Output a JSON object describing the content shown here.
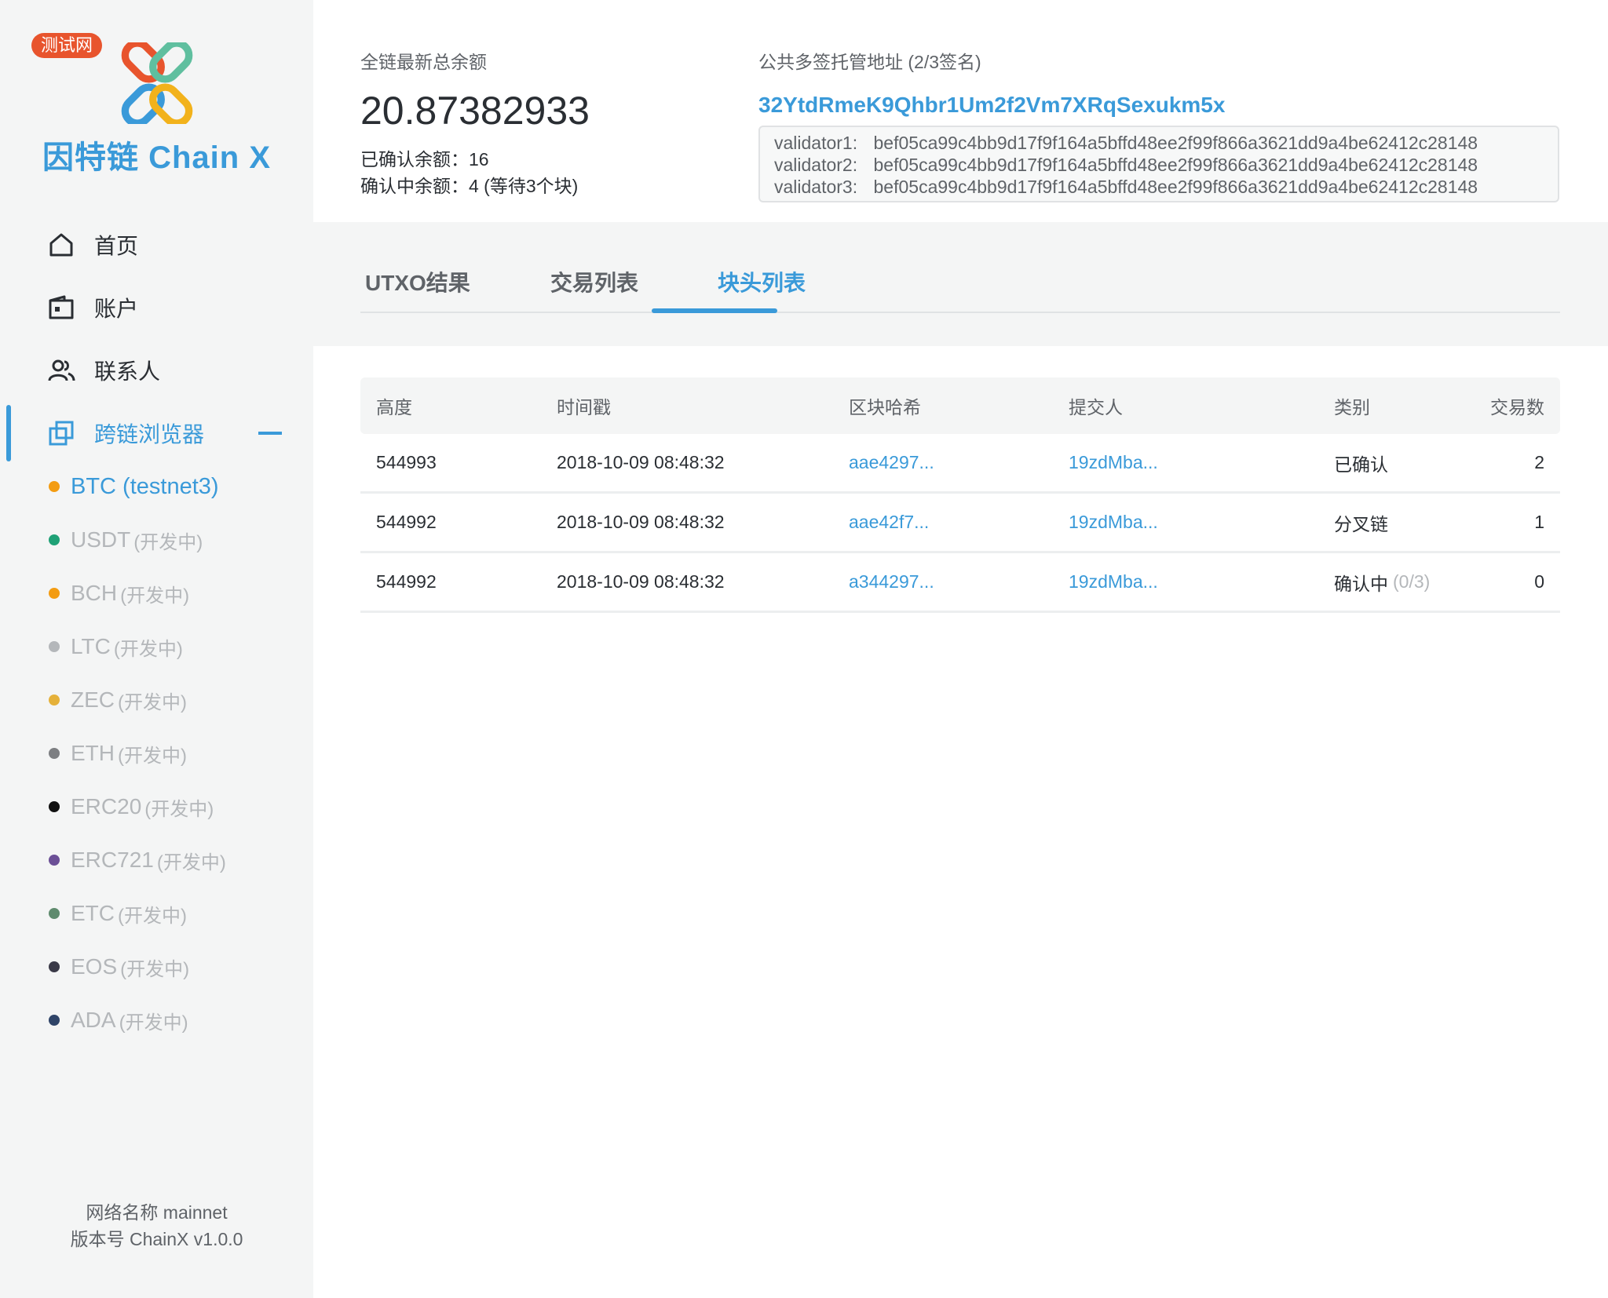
{
  "brand": {
    "test_badge": "测试网",
    "logo_text": "因特链 Chain X"
  },
  "nav": {
    "items": [
      {
        "label": "首页",
        "icon": "home-icon"
      },
      {
        "label": "账户",
        "icon": "wallet-icon"
      },
      {
        "label": "联系人",
        "icon": "contacts-icon"
      },
      {
        "label": "跨链浏览器",
        "icon": "cross-chain-icon"
      }
    ]
  },
  "chains": [
    {
      "name": "BTC (testnet3)",
      "sub": "",
      "color": "#f39c12"
    },
    {
      "name": "USDT",
      "sub": "(开发中)",
      "color": "#1fa176"
    },
    {
      "name": "BCH",
      "sub": "(开发中)",
      "color": "#f39c12"
    },
    {
      "name": "LTC",
      "sub": "(开发中)",
      "color": "#b4b7ba"
    },
    {
      "name": "ZEC",
      "sub": "(开发中)",
      "color": "#e5b13a"
    },
    {
      "name": "ETH",
      "sub": "(开发中)",
      "color": "#7d7f82"
    },
    {
      "name": "ERC20",
      "sub": "(开发中)",
      "color": "#111111"
    },
    {
      "name": "ERC721",
      "sub": "(开发中)",
      "color": "#6b4f96"
    },
    {
      "name": "ETC",
      "sub": "(开发中)",
      "color": "#5f8b6e"
    },
    {
      "name": "EOS",
      "sub": "(开发中)",
      "color": "#3a3a48"
    },
    {
      "name": "ADA",
      "sub": "(开发中)",
      "color": "#2f4468"
    }
  ],
  "footer": {
    "network": "网络名称 mainnet",
    "version": "版本号 ChainX v1.0.0"
  },
  "balance": {
    "label": "全链最新总余额",
    "value": "20.87382933",
    "confirmed": "已确认余额：16",
    "pending": "确认中余额：4 (等待3个块)"
  },
  "multisig": {
    "label": "公共多签托管地址 (2/3签名)",
    "address": "32YtdRmeK9Qhbr1Um2f2Vm7XRqSexukm5x",
    "validators": [
      {
        "name": "validator1:",
        "key": "bef05ca99c4bb9d17f9f164a5bffd48ee2f99f866a3621dd9a4be62412c28148"
      },
      {
        "name": "validator2:",
        "key": "bef05ca99c4bb9d17f9f164a5bffd48ee2f99f866a3621dd9a4be62412c28148"
      },
      {
        "name": "validator3:",
        "key": "bef05ca99c4bb9d17f9f164a5bffd48ee2f99f866a3621dd9a4be62412c28148"
      }
    ]
  },
  "tabs": [
    "UTXO结果",
    "交易列表",
    "块头列表"
  ],
  "active_tab": "块头列表",
  "table": {
    "headers": [
      "高度",
      "时间戳",
      "区块哈希",
      "提交人",
      "类别",
      "交易数"
    ],
    "rows": [
      {
        "height": "544993",
        "time": "2018-10-09 08:48:32",
        "hash": "aae4297...",
        "submitter": "19zdMba...",
        "category": "已确认",
        "progress": "",
        "tx": "2"
      },
      {
        "height": "544992",
        "time": "2018-10-09 08:48:32",
        "hash": "aae42f7...",
        "submitter": "19zdMba...",
        "category": "分叉链",
        "progress": "",
        "tx": "1"
      },
      {
        "height": "544992",
        "time": "2018-10-09 08:48:32",
        "hash": "a344297...",
        "submitter": "19zdMba...",
        "category": "确认中",
        "progress": "(0/3)",
        "tx": "0"
      }
    ]
  }
}
